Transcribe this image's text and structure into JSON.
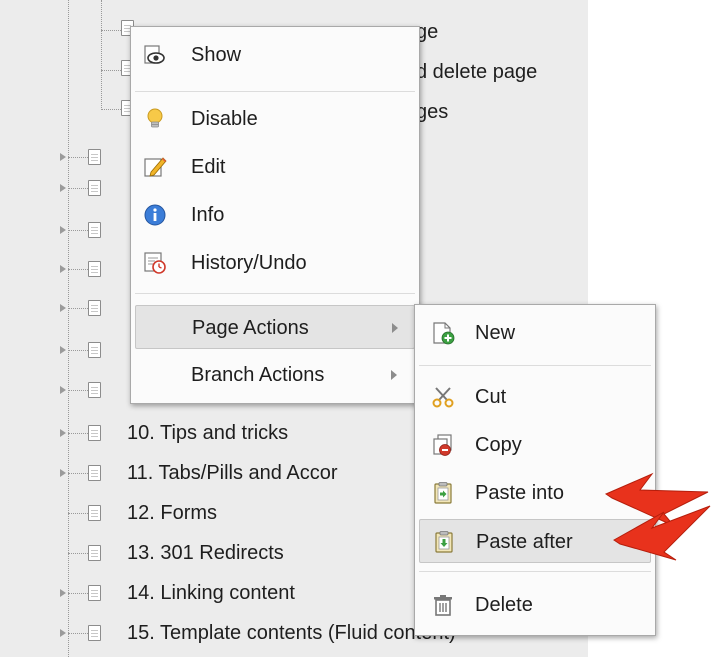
{
  "tree": {
    "top_items": [
      {
        "label": "ge"
      },
      {
        "label": "d delete page"
      },
      {
        "label": "ges"
      }
    ],
    "items": [
      {
        "label": "10. Tips and tricks",
        "has_children": true
      },
      {
        "label": "11. Tabs/Pills and Accor",
        "has_children": true
      },
      {
        "label": "12. Forms",
        "has_children": false
      },
      {
        "label": "13. 301 Redirects",
        "has_children": false
      },
      {
        "label": "14. Linking content",
        "has_children": true
      },
      {
        "label": "15. Template contents (Fluid content)",
        "has_children": true
      }
    ]
  },
  "context_menu": {
    "show": "Show",
    "disable": "Disable",
    "edit": "Edit",
    "info": "Info",
    "history": "History/Undo",
    "page_actions": "Page Actions",
    "branch_actions": "Branch Actions"
  },
  "submenu": {
    "new": "New",
    "cut": "Cut",
    "copy": "Copy",
    "paste_into": "Paste into",
    "paste_after": "Paste after",
    "delete": "Delete"
  },
  "colors": {
    "tree_bg": "#ececec",
    "menu_bg": "#fbfbfb",
    "highlight_bg": "#e4e4e4",
    "callout_red": "#e8321c"
  }
}
